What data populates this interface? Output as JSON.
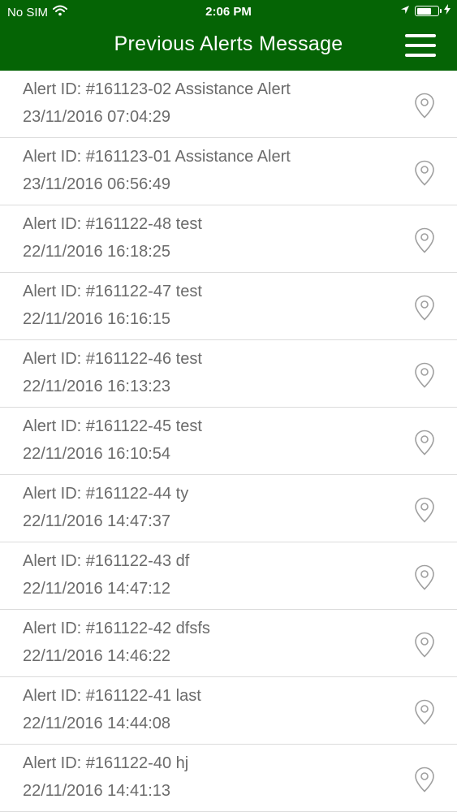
{
  "status_bar": {
    "carrier": "No SIM",
    "time": "2:06 PM",
    "battery_level": 0.72
  },
  "header": {
    "title": "Previous Alerts Message",
    "menu_icon": "hamburger-menu-icon"
  },
  "alerts": [
    {
      "title": "Alert ID: #161123-02 Assistance Alert",
      "time": "23/11/2016 07:04:29"
    },
    {
      "title": "Alert ID: #161123-01 Assistance Alert",
      "time": "23/11/2016 06:56:49"
    },
    {
      "title": "Alert ID: #161122-48 test",
      "time": "22/11/2016 16:18:25"
    },
    {
      "title": "Alert ID: #161122-47 test",
      "time": "22/11/2016 16:16:15"
    },
    {
      "title": "Alert ID: #161122-46 test",
      "time": "22/11/2016 16:13:23"
    },
    {
      "title": "Alert ID: #161122-45 test",
      "time": "22/11/2016 16:10:54"
    },
    {
      "title": "Alert ID: #161122-44 ty",
      "time": "22/11/2016 14:47:37"
    },
    {
      "title": "Alert ID: #161122-43 df",
      "time": "22/11/2016 14:47:12"
    },
    {
      "title": "Alert ID: #161122-42 dfsfs",
      "time": "22/11/2016 14:46:22"
    },
    {
      "title": "Alert ID: #161122-41 last",
      "time": "22/11/2016 14:44:08"
    },
    {
      "title": "Alert ID: #161122-40 hj",
      "time": "22/11/2016 14:41:13"
    }
  ],
  "colors": {
    "header_bg": "#056405",
    "text": "#6b6b6b",
    "divider": "#dcdcdc",
    "pin": "#a0a0a0"
  }
}
